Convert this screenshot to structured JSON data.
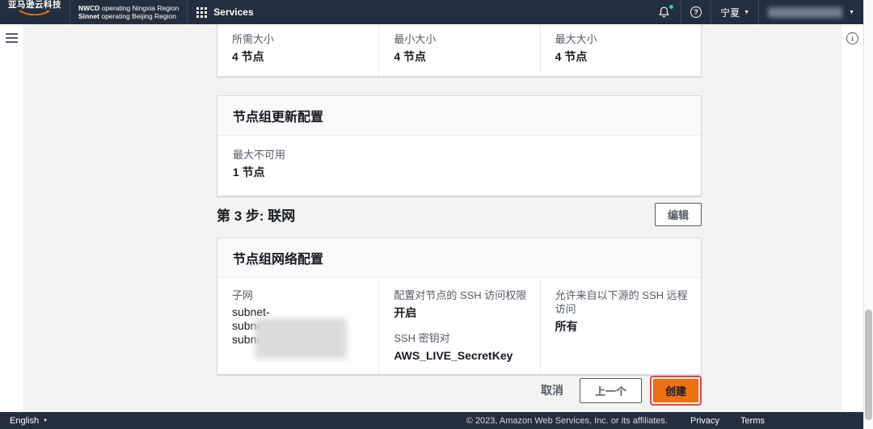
{
  "topnav": {
    "logo_text": "亚马逊云科技",
    "operator": {
      "line1_bold": "NWCD",
      "line1_rest": " operating Ningxia Region",
      "line2_bold": "Sinnet",
      "line2_rest": " operating Beijing Region"
    },
    "services_label": "Services",
    "region_label": "宁夏"
  },
  "icons": {
    "caret_down": "▼",
    "help": "?",
    "info": "i"
  },
  "content": {
    "scaling_card": {
      "fields": [
        {
          "label": "所需大小",
          "value": "4 节点"
        },
        {
          "label": "最小大小",
          "value": "4 节点"
        },
        {
          "label": "最大大小",
          "value": "4 节点"
        }
      ]
    },
    "update_card": {
      "title": "节点组更新配置",
      "field": {
        "label": "最大不可用",
        "value": "1 节点"
      }
    },
    "step3": {
      "heading": "第 3 步: 联网",
      "edit_label": "编辑"
    },
    "network_card": {
      "title": "节点组网络配置",
      "subnets": {
        "label": "子网",
        "items": [
          "subnet-",
          "subnet-",
          "subnet-"
        ],
        "values_redacted": true
      },
      "ssh_access": {
        "label": "配置对节点的 SSH 访问权限",
        "value": "开启"
      },
      "ssh_key": {
        "label": "SSH 密钥对",
        "value": "AWS_LIVE_SecretKey"
      },
      "ssh_source": {
        "label": "允许来自以下源的 SSH 远程访问",
        "value": "所有"
      }
    },
    "actions": {
      "cancel_label": "取消",
      "previous_label": "上一个",
      "create_label": "创建"
    }
  },
  "footer": {
    "language_label": "English",
    "copyright": "© 2023, Amazon Web Services, Inc. or its affiliates.",
    "privacy_label": "Privacy",
    "terms_label": "Terms"
  },
  "colors": {
    "navbar_bg": "#232f3e",
    "accent_orange": "#ec7211",
    "notification_dot": "#3ebcd2",
    "highlight_red": "#e8453c",
    "content_bg": "#f2f3f3",
    "label_grey": "#545b64",
    "value_text": "#16191f"
  }
}
